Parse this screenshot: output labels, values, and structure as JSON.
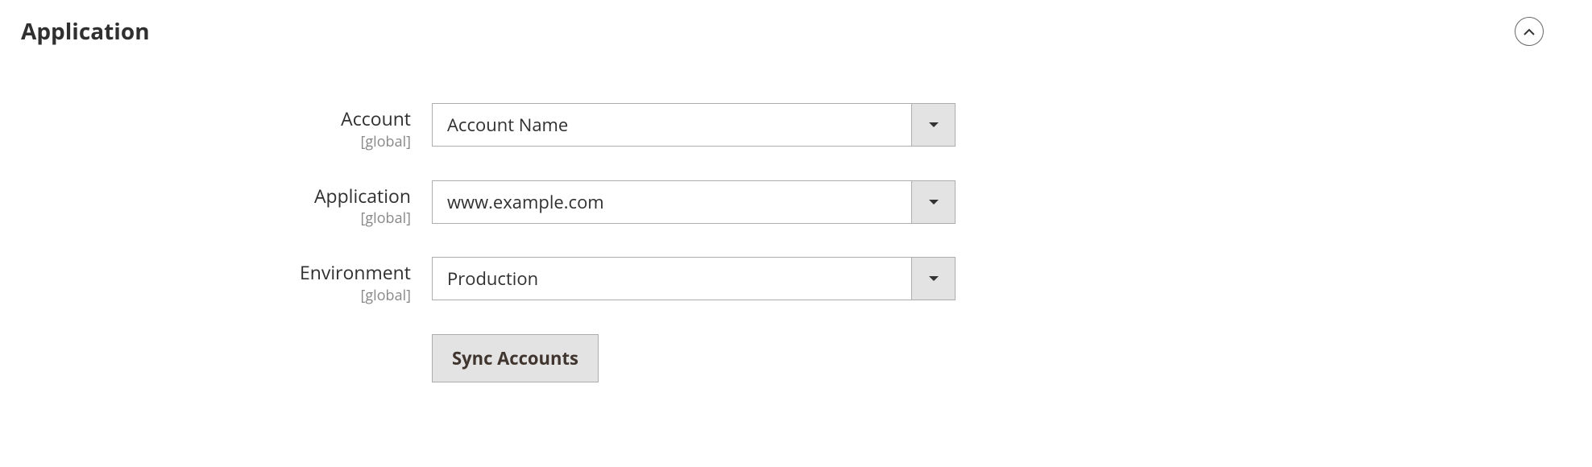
{
  "section": {
    "title": "Application"
  },
  "fields": {
    "account": {
      "label": "Account",
      "scope": "[global]",
      "value": "Account Name"
    },
    "application": {
      "label": "Application",
      "scope": "[global]",
      "value": "www.example.com"
    },
    "environment": {
      "label": "Environment",
      "scope": "[global]",
      "value": "Production"
    }
  },
  "actions": {
    "sync_label": "Sync Accounts"
  }
}
